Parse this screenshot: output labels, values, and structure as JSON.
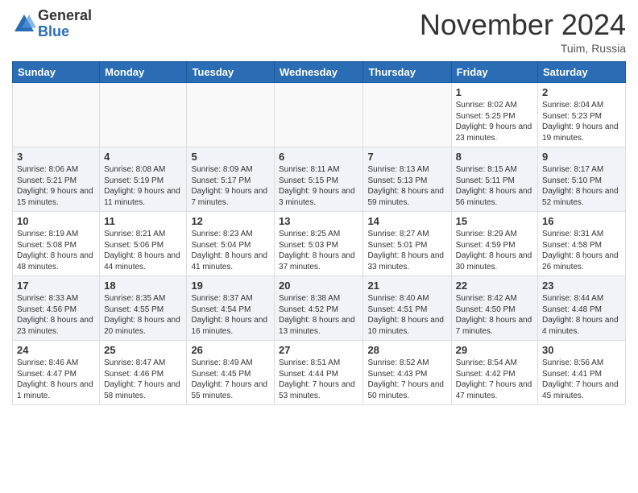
{
  "logo": {
    "general": "General",
    "blue": "Blue"
  },
  "title": "November 2024",
  "location": "Tuim, Russia",
  "days_of_week": [
    "Sunday",
    "Monday",
    "Tuesday",
    "Wednesday",
    "Thursday",
    "Friday",
    "Saturday"
  ],
  "weeks": [
    [
      {
        "day": "",
        "info": ""
      },
      {
        "day": "",
        "info": ""
      },
      {
        "day": "",
        "info": ""
      },
      {
        "day": "",
        "info": ""
      },
      {
        "day": "",
        "info": ""
      },
      {
        "day": "1",
        "info": "Sunrise: 8:02 AM\nSunset: 5:25 PM\nDaylight: 9 hours and 23 minutes."
      },
      {
        "day": "2",
        "info": "Sunrise: 8:04 AM\nSunset: 5:23 PM\nDaylight: 9 hours and 19 minutes."
      }
    ],
    [
      {
        "day": "3",
        "info": "Sunrise: 8:06 AM\nSunset: 5:21 PM\nDaylight: 9 hours and 15 minutes."
      },
      {
        "day": "4",
        "info": "Sunrise: 8:08 AM\nSunset: 5:19 PM\nDaylight: 9 hours and 11 minutes."
      },
      {
        "day": "5",
        "info": "Sunrise: 8:09 AM\nSunset: 5:17 PM\nDaylight: 9 hours and 7 minutes."
      },
      {
        "day": "6",
        "info": "Sunrise: 8:11 AM\nSunset: 5:15 PM\nDaylight: 9 hours and 3 minutes."
      },
      {
        "day": "7",
        "info": "Sunrise: 8:13 AM\nSunset: 5:13 PM\nDaylight: 8 hours and 59 minutes."
      },
      {
        "day": "8",
        "info": "Sunrise: 8:15 AM\nSunset: 5:11 PM\nDaylight: 8 hours and 56 minutes."
      },
      {
        "day": "9",
        "info": "Sunrise: 8:17 AM\nSunset: 5:10 PM\nDaylight: 8 hours and 52 minutes."
      }
    ],
    [
      {
        "day": "10",
        "info": "Sunrise: 8:19 AM\nSunset: 5:08 PM\nDaylight: 8 hours and 48 minutes."
      },
      {
        "day": "11",
        "info": "Sunrise: 8:21 AM\nSunset: 5:06 PM\nDaylight: 8 hours and 44 minutes."
      },
      {
        "day": "12",
        "info": "Sunrise: 8:23 AM\nSunset: 5:04 PM\nDaylight: 8 hours and 41 minutes."
      },
      {
        "day": "13",
        "info": "Sunrise: 8:25 AM\nSunset: 5:03 PM\nDaylight: 8 hours and 37 minutes."
      },
      {
        "day": "14",
        "info": "Sunrise: 8:27 AM\nSunset: 5:01 PM\nDaylight: 8 hours and 33 minutes."
      },
      {
        "day": "15",
        "info": "Sunrise: 8:29 AM\nSunset: 4:59 PM\nDaylight: 8 hours and 30 minutes."
      },
      {
        "day": "16",
        "info": "Sunrise: 8:31 AM\nSunset: 4:58 PM\nDaylight: 8 hours and 26 minutes."
      }
    ],
    [
      {
        "day": "17",
        "info": "Sunrise: 8:33 AM\nSunset: 4:56 PM\nDaylight: 8 hours and 23 minutes."
      },
      {
        "day": "18",
        "info": "Sunrise: 8:35 AM\nSunset: 4:55 PM\nDaylight: 8 hours and 20 minutes."
      },
      {
        "day": "19",
        "info": "Sunrise: 8:37 AM\nSunset: 4:54 PM\nDaylight: 8 hours and 16 minutes."
      },
      {
        "day": "20",
        "info": "Sunrise: 8:38 AM\nSunset: 4:52 PM\nDaylight: 8 hours and 13 minutes."
      },
      {
        "day": "21",
        "info": "Sunrise: 8:40 AM\nSunset: 4:51 PM\nDaylight: 8 hours and 10 minutes."
      },
      {
        "day": "22",
        "info": "Sunrise: 8:42 AM\nSunset: 4:50 PM\nDaylight: 8 hours and 7 minutes."
      },
      {
        "day": "23",
        "info": "Sunrise: 8:44 AM\nSunset: 4:48 PM\nDaylight: 8 hours and 4 minutes."
      }
    ],
    [
      {
        "day": "24",
        "info": "Sunrise: 8:46 AM\nSunset: 4:47 PM\nDaylight: 8 hours and 1 minute."
      },
      {
        "day": "25",
        "info": "Sunrise: 8:47 AM\nSunset: 4:46 PM\nDaylight: 7 hours and 58 minutes."
      },
      {
        "day": "26",
        "info": "Sunrise: 8:49 AM\nSunset: 4:45 PM\nDaylight: 7 hours and 55 minutes."
      },
      {
        "day": "27",
        "info": "Sunrise: 8:51 AM\nSunset: 4:44 PM\nDaylight: 7 hours and 53 minutes."
      },
      {
        "day": "28",
        "info": "Sunrise: 8:52 AM\nSunset: 4:43 PM\nDaylight: 7 hours and 50 minutes."
      },
      {
        "day": "29",
        "info": "Sunrise: 8:54 AM\nSunset: 4:42 PM\nDaylight: 7 hours and 47 minutes."
      },
      {
        "day": "30",
        "info": "Sunrise: 8:56 AM\nSunset: 4:41 PM\nDaylight: 7 hours and 45 minutes."
      }
    ]
  ]
}
